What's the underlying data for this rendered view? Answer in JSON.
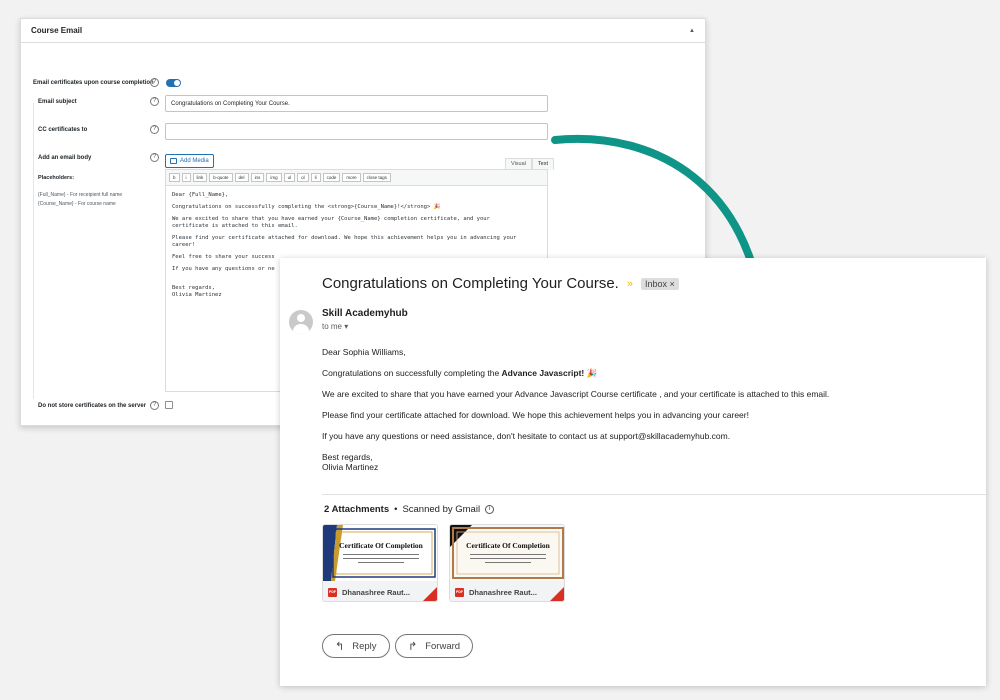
{
  "admin": {
    "panel_title": "Course Email",
    "collapse_icon": "▲",
    "email_certificates_label": "Email certificates upon course completion",
    "email_subject_label": "Email subject",
    "email_subject_value": "Congratulations on Completing Your Course.",
    "cc_label": "CC certificates to",
    "cc_value": "",
    "body_label": "Add an email body",
    "add_media_label": "Add Media",
    "tabs": [
      "Visual",
      "Text"
    ],
    "quicktags": [
      "b",
      "i",
      "link",
      "b-quote",
      "del",
      "ins",
      "img",
      "ul",
      "ol",
      "li",
      "code",
      "more",
      "close tags"
    ],
    "placeholders_title": "Placeholders:",
    "placeholders": [
      "{Full_Name} - For receipient full name",
      "{Course_Name} - For course name"
    ],
    "editor_lines": [
      "Dear {Full_Name},",
      "Congratulations on successfully completing the <strong>{Course_Name}!</strong> 🎉",
      "We are excited to share that you have earned your {Course_Name} completion certificate, and your\ncertificate is attached to this email.",
      "Please find your certificate attached for download. We hope this achievement helps you in advancing your\ncareer!",
      "Feel free to share your success",
      "If you have any questions or ne",
      "\nBest regards,\nOlivia Martinez"
    ],
    "no_store_label": "Do not store certificates on the server"
  },
  "mail": {
    "subject": "Congratulations on Completing Your Course.",
    "importance_icon": "»",
    "inbox_label": "Inbox",
    "inbox_close": "×",
    "sender": "Skill Academyhub",
    "to": "to me",
    "to_caret": "▾",
    "greeting": "Dear Sophia Williams,",
    "congrats_prefix": "Congratulations on successfully completing the ",
    "course_name": "Advance Javascript!",
    "party_icon": "🎉",
    "para_earned": "We are excited to share that you have earned your Advance Javascript Course certificate , and your certificate is attached to this email.",
    "para_download": "Please find your certificate attached for download. We hope this achievement helps you in advancing your career!",
    "para_questions": "If you have any questions or need assistance, don't hesitate to contact us at support@skillacademyhub.com.",
    "regards": "Best regards,",
    "signature": "Olivia Martinez",
    "attachments_count": "2 Attachments",
    "bullet": "•",
    "scanned": "Scanned by Gmail",
    "info_icon": "i",
    "attachments": [
      {
        "cert_title": "Certificate Of Completion",
        "name": "Dhanashree Raut...",
        "file_type": "PDF"
      },
      {
        "cert_title": "Certificate Of Completion",
        "name": "Dhanashree Raut...",
        "file_type": "PDF"
      }
    ],
    "reply_label": "Reply",
    "forward_label": "Forward",
    "reply_icon": "↰",
    "forward_icon": "↱"
  },
  "colors": {
    "arrow": "#0f9488",
    "toggle_on": "#2271b1",
    "pdf_red": "#d93025"
  }
}
